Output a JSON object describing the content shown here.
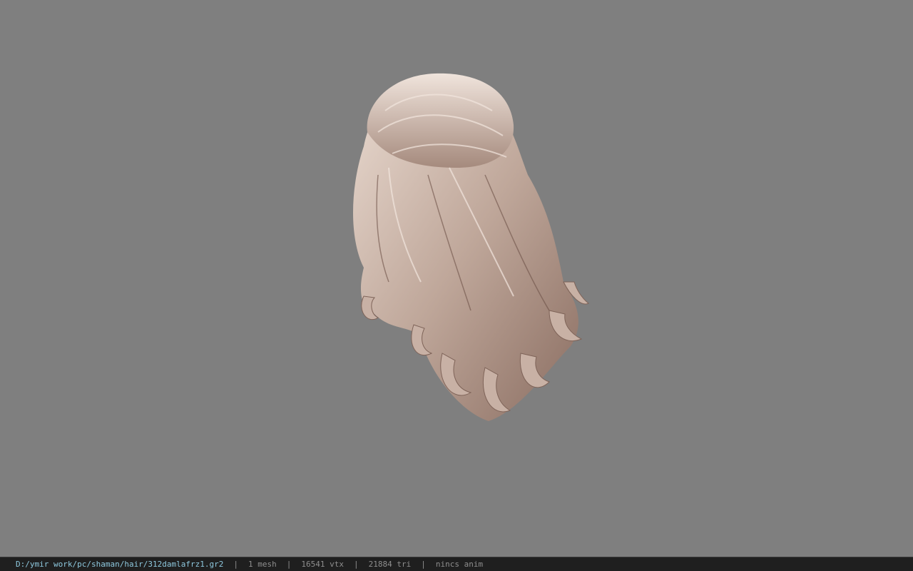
{
  "viewport": {
    "background_color": "#7f7f7f",
    "model": {
      "icon": "hair-model",
      "colors": {
        "light": "#e6d6cc",
        "mid": "#b8a093",
        "dark": "#7a6055"
      }
    }
  },
  "statusbar": {
    "file_path": "D:/ymir work/pc/shaman/hair/312damlafrz1.gr2",
    "separator": "|",
    "mesh": "1 mesh",
    "vertices": "16541 vtx",
    "triangles": "21884 tri",
    "anim": "nincs anim",
    "path_color": "#8ec8de",
    "text_color": "#8e8e8e"
  }
}
